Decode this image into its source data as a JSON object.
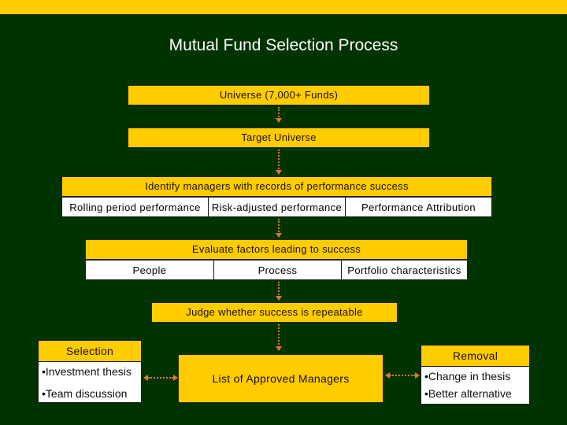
{
  "title": "Mutual Fund Selection Process",
  "colors": {
    "background": "#003300",
    "accent": "#ffcc00",
    "connector": "#d97a26"
  },
  "steps": {
    "universe": "Universe (7,000+ Funds)",
    "target": "Target Universe",
    "identify": {
      "label": "Identify managers with records of performance success",
      "criteria": [
        "Rolling period performance",
        "Risk-adjusted performance",
        "Performance Attribution"
      ]
    },
    "evaluate": {
      "label": "Evaluate factors leading to success",
      "factors": [
        "People",
        "Process",
        "Portfolio characteristics"
      ]
    },
    "judge": "Judge whether success is repeatable",
    "approved": "List of Approved Managers"
  },
  "selection": {
    "heading": "Selection",
    "items": [
      "•Investment thesis",
      "•Team discussion"
    ]
  },
  "removal": {
    "heading": "Removal",
    "items": [
      "•Change in thesis",
      "•Better alternative"
    ]
  }
}
